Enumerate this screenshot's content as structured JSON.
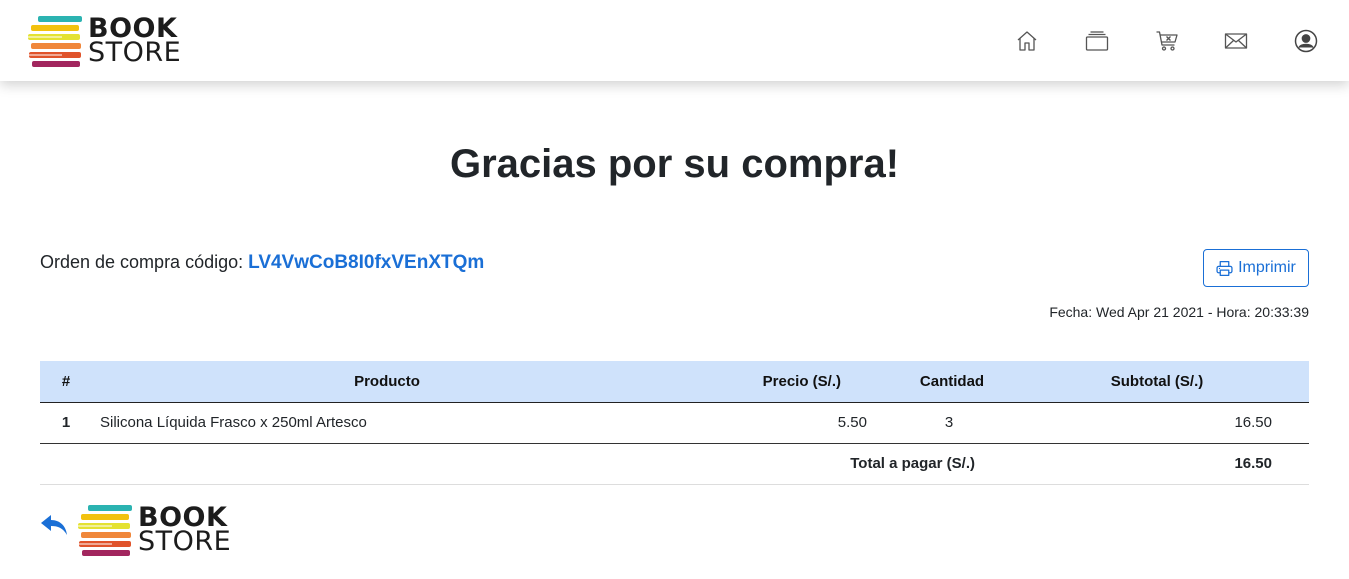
{
  "brand": {
    "line1": "BOOK",
    "line2": "STORE"
  },
  "nav": {
    "icons": [
      "home-icon",
      "catalog-icon",
      "cart-icon",
      "mail-icon",
      "user-icon"
    ]
  },
  "page": {
    "title": "Gracias por su compra!",
    "order_label": "Orden de compra código: ",
    "order_code": "LV4VwCoB8I0fxVEnXTQm",
    "print_label": "Imprimir",
    "date_line": "Fecha: Wed Apr 21 2021 - Hora: 20:33:39"
  },
  "table": {
    "headers": [
      "#",
      "Producto",
      "Precio (S/.)",
      "Cantidad",
      "Subtotal (S/.)"
    ],
    "rows": [
      {
        "num": "1",
        "product": "Silicona Líquida Frasco x 250ml Artesco",
        "price": "5.50",
        "qty": "3",
        "subtotal": "16.50"
      }
    ],
    "total_label": "Total a pagar (S/.)",
    "total_value": "16.50"
  },
  "colors": {
    "accent": "#1a6fd6",
    "table_header": "#cfe2fb",
    "logo_stripes": [
      "#2bb3b1",
      "#f2c20f",
      "#e4e232",
      "#f0873a",
      "#e0532b",
      "#a2265e"
    ]
  }
}
